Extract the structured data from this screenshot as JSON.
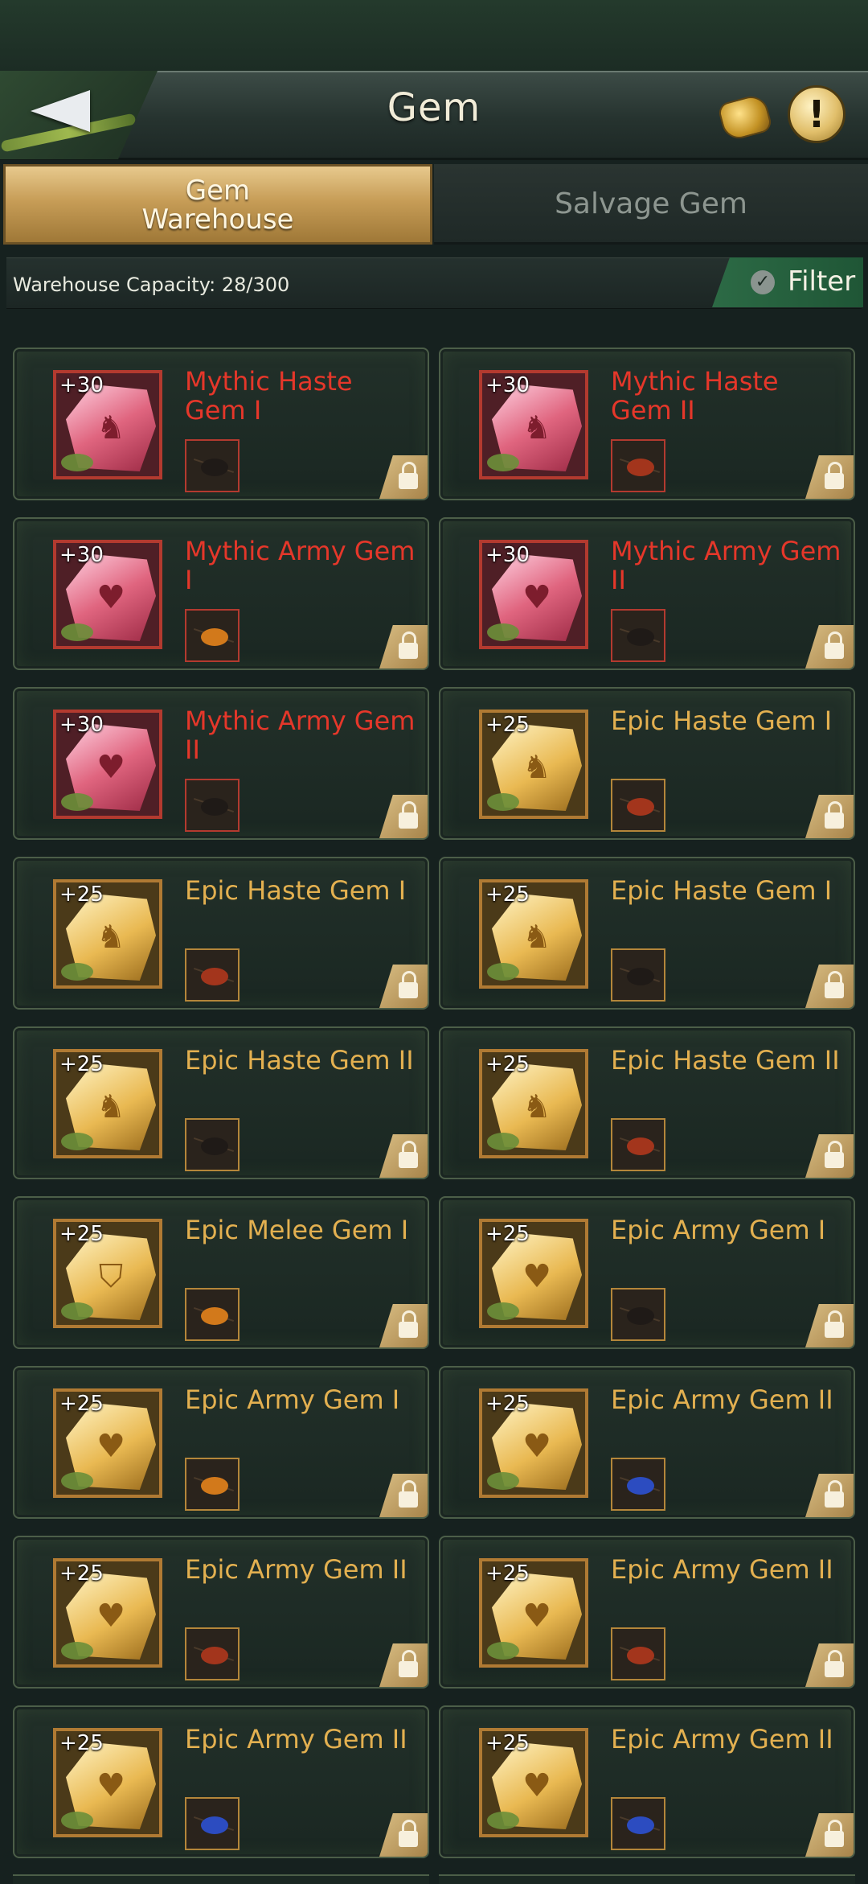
{
  "header": {
    "title": "Gem"
  },
  "tabs": {
    "active_label": "Gem\nWarehouse",
    "inactive_label": "Salvage Gem"
  },
  "capacity": {
    "text": "Warehouse Capacity: 28/300"
  },
  "filter": {
    "label": "Filter"
  },
  "gems": [
    {
      "level": "+30",
      "name": "Mythic Haste Gem I",
      "rarity": "mythic",
      "symbol": "boot",
      "ant": "dark"
    },
    {
      "level": "+30",
      "name": "Mythic Haste Gem II",
      "rarity": "mythic",
      "symbol": "boot",
      "ant": "red"
    },
    {
      "level": "+30",
      "name": "Mythic Army Gem I",
      "rarity": "mythic",
      "symbol": "heart",
      "ant": "orange"
    },
    {
      "level": "+30",
      "name": "Mythic Army Gem II",
      "rarity": "mythic",
      "symbol": "heart",
      "ant": "dark"
    },
    {
      "level": "+30",
      "name": "Mythic Army Gem II",
      "rarity": "mythic",
      "symbol": "heart",
      "ant": "dark"
    },
    {
      "level": "+25",
      "name": "Epic Haste Gem I",
      "rarity": "epic",
      "symbol": "boot",
      "ant": "red"
    },
    {
      "level": "+25",
      "name": "Epic Haste Gem I",
      "rarity": "epic",
      "symbol": "boot",
      "ant": "red"
    },
    {
      "level": "+25",
      "name": "Epic Haste Gem I",
      "rarity": "epic",
      "symbol": "boot",
      "ant": "dark"
    },
    {
      "level": "+25",
      "name": "Epic Haste Gem II",
      "rarity": "epic",
      "symbol": "boot",
      "ant": "dark"
    },
    {
      "level": "+25",
      "name": "Epic Haste Gem II",
      "rarity": "epic",
      "symbol": "boot",
      "ant": "red"
    },
    {
      "level": "+25",
      "name": "Epic Melee Gem I",
      "rarity": "epic",
      "symbol": "shield",
      "ant": "orange"
    },
    {
      "level": "+25",
      "name": "Epic Army Gem I",
      "rarity": "epic",
      "symbol": "heart",
      "ant": "dark"
    },
    {
      "level": "+25",
      "name": "Epic Army Gem I",
      "rarity": "epic",
      "symbol": "heart",
      "ant": "orange"
    },
    {
      "level": "+25",
      "name": "Epic Army Gem II",
      "rarity": "epic",
      "symbol": "heart",
      "ant": "blue"
    },
    {
      "level": "+25",
      "name": "Epic Army Gem II",
      "rarity": "epic",
      "symbol": "heart",
      "ant": "red"
    },
    {
      "level": "+25",
      "name": "Epic Army Gem II",
      "rarity": "epic",
      "symbol": "heart",
      "ant": "red"
    },
    {
      "level": "+25",
      "name": "Epic Army Gem II",
      "rarity": "epic",
      "symbol": "heart",
      "ant": "blue"
    },
    {
      "level": "+25",
      "name": "Epic Army Gem II",
      "rarity": "epic",
      "symbol": "heart",
      "ant": "blue"
    }
  ],
  "icons": {
    "back": "back-arrow-icon",
    "reward": "reward-chest-icon",
    "info": "info-icon",
    "lock": "lock-icon",
    "filter_check": "checkmark-icon"
  }
}
